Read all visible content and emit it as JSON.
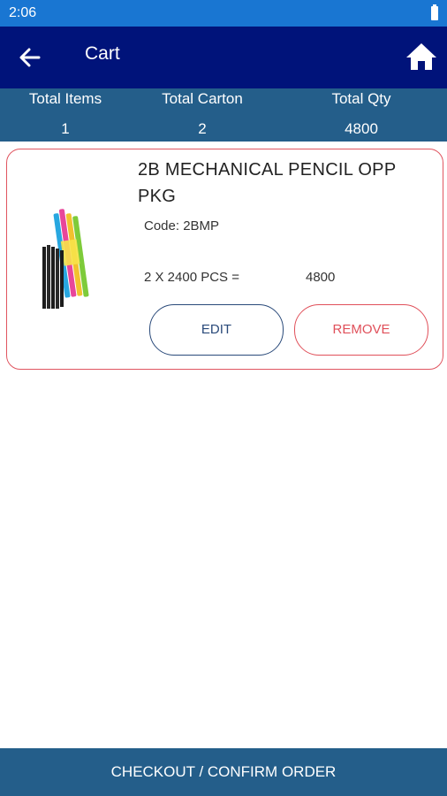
{
  "status_bar": {
    "time": "2:06"
  },
  "app_bar": {
    "title": "Cart"
  },
  "summary": {
    "total_items_label": "Total Items",
    "total_items_value": "1",
    "total_carton_label": "Total Carton",
    "total_carton_value": "2",
    "total_qty_label": "Total Qty",
    "total_qty_value": "4800"
  },
  "cart_items": [
    {
      "name": "2B MECHANICAL PENCIL OPP PKG",
      "code": "Code: 2BMP",
      "qty_formula": "2 X 2400 PCS =",
      "qty_total": "4800",
      "edit_label": "EDIT",
      "remove_label": "REMOVE"
    }
  ],
  "checkout": {
    "label": "CHECKOUT / CONFIRM ORDER"
  },
  "colors": {
    "status_bar": "#1976d2",
    "app_bar": "#00137a",
    "summary_bar": "#245e8a",
    "card_border": "#e05560",
    "edit_accent": "#2a4a7a",
    "remove_accent": "#e0505a"
  },
  "icons": {
    "back": "arrow-left-icon",
    "home": "home-icon",
    "battery": "battery-icon"
  }
}
